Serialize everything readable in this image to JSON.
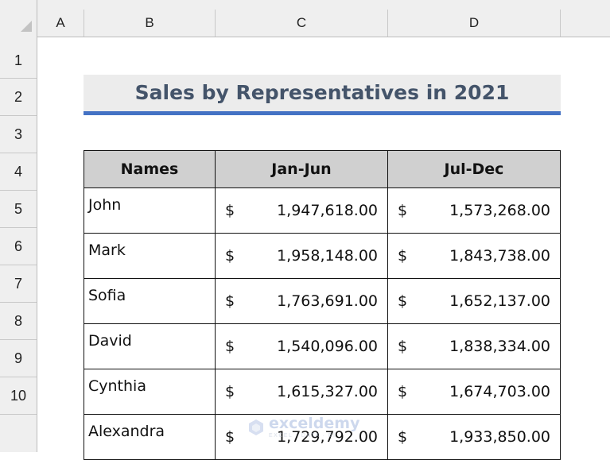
{
  "sheet": {
    "columns": [
      "A",
      "B",
      "C",
      "D"
    ],
    "rows": [
      "1",
      "2",
      "3",
      "4",
      "5",
      "6",
      "7",
      "8",
      "9",
      "10"
    ]
  },
  "title": "Sales by Representatives in 2021",
  "table": {
    "headers": [
      "Names",
      "Jan-Jun",
      "Jul-Dec"
    ],
    "currency_symbol": "$",
    "rows": [
      {
        "name": "John",
        "jan_jun": "1,947,618.00",
        "jul_dec": "1,573,268.00"
      },
      {
        "name": "Mark",
        "jan_jun": "1,958,148.00",
        "jul_dec": "1,843,738.00"
      },
      {
        "name": "Sofia",
        "jan_jun": "1,763,691.00",
        "jul_dec": "1,652,137.00"
      },
      {
        "name": "David",
        "jan_jun": "1,540,096.00",
        "jul_dec": "1,838,334.00"
      },
      {
        "name": "Cynthia",
        "jan_jun": "1,615,327.00",
        "jul_dec": "1,674,703.00"
      },
      {
        "name": "Alexandra",
        "jan_jun": "1,729,792.00",
        "jul_dec": "1,933,850.00"
      }
    ]
  },
  "watermark": {
    "brand": "exceldemy",
    "tagline": "EXCEL · DATA · BI"
  },
  "colors": {
    "title_text": "#44546a",
    "title_underline": "#4472c4",
    "header_fill": "#d0d0d0"
  }
}
